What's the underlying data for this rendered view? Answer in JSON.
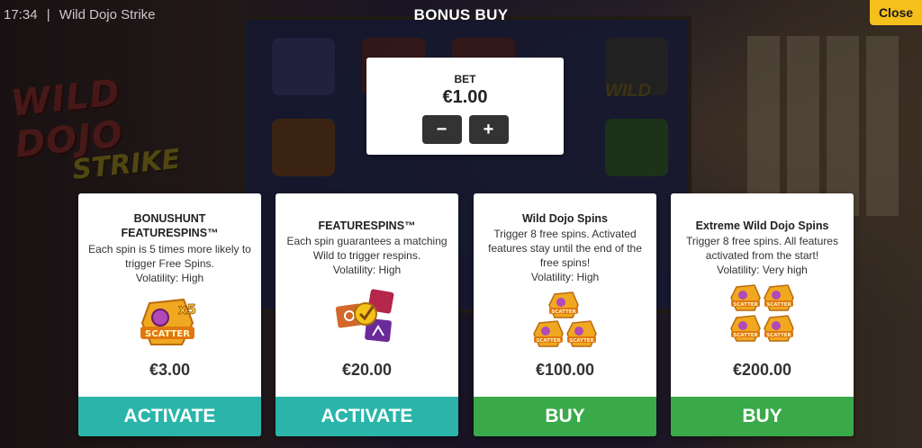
{
  "status": {
    "time": "17:34",
    "separator": "|",
    "game_name": "Wild Dojo Strike"
  },
  "background": {
    "logo_line1": "WILD DOJO",
    "logo_line2": "STRIKE",
    "wild_label": "WILD"
  },
  "dialog": {
    "title": "BONUS BUY",
    "close_label": "Close"
  },
  "bet": {
    "label": "BET",
    "value": "€1.00",
    "decrease_label": "−",
    "increase_label": "+"
  },
  "cards": [
    {
      "title_line1": "BONUSHUNT",
      "title_line2": "FEATURESPINS™",
      "description": "Each spin is 5 times more likely to trigger Free Spins.",
      "volatility": "Volatility: High",
      "art_label": "SCATTER",
      "art_badge": "x5",
      "price": "€3.00",
      "action_label": "ACTIVATE",
      "action_color": "#2bb5aa"
    },
    {
      "title_line1": "FEATURESPINS™",
      "description": "Each spin guarantees a matching Wild to trigger respins.",
      "volatility": "Volatility: High",
      "price": "€20.00",
      "action_label": "ACTIVATE",
      "action_color": "#2bb5aa"
    },
    {
      "title_line1": "Wild Dojo Spins",
      "description": "Trigger 8 free spins. Activated features stay until the end of the free spins!",
      "volatility": "Volatility: High",
      "art_label": "SCATTER",
      "art_count": 3,
      "price": "€100.00",
      "action_label": "BUY",
      "action_color": "#3aa94a"
    },
    {
      "title_line1": "Extreme Wild Dojo Spins",
      "description": "Trigger 8 free spins. All features activated from the start!",
      "volatility": "Volatility: Very high",
      "art_label": "SCATTER",
      "art_count": 4,
      "price": "€200.00",
      "action_label": "BUY",
      "action_color": "#3aa94a"
    }
  ],
  "colors": {
    "close_button": "#f5bf1c",
    "activate": "#2bb5aa",
    "buy": "#3aa94a",
    "scatter_gold": "#f0a820",
    "scatter_purple": "#b04ab8"
  }
}
